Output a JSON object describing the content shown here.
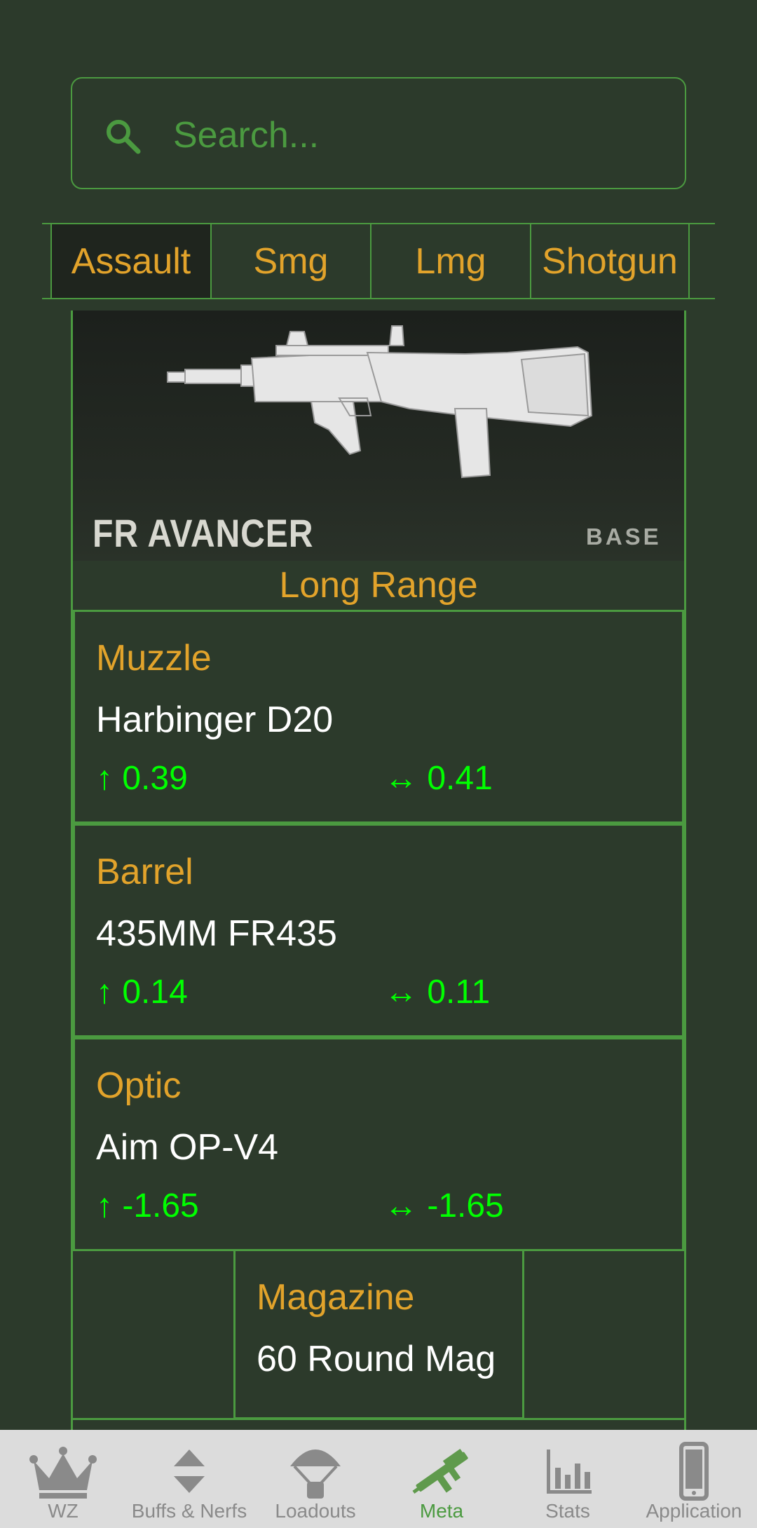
{
  "search": {
    "placeholder": "Search...",
    "value": ""
  },
  "tabs": [
    {
      "label": "Assault",
      "active": true
    },
    {
      "label": "Smg",
      "active": false
    },
    {
      "label": "Lmg",
      "active": false
    },
    {
      "label": "Shotgun",
      "active": false
    }
  ],
  "weapon": {
    "name": "FR AVANCER",
    "tag": "BASE",
    "loadout_title": "Long Range"
  },
  "attachments": [
    {
      "slot": "Muzzle",
      "name": "Harbinger D20",
      "vertical": "↑ 0.39",
      "horizontal": "↔ 0.41"
    },
    {
      "slot": "Barrel",
      "name": "435MM FR435",
      "vertical": "↑ 0.14",
      "horizontal": "↔ 0.11"
    },
    {
      "slot": "Optic",
      "name": "Aim OP-V4",
      "vertical": "↑ -1.65",
      "horizontal": "↔ -1.65"
    }
  ],
  "magazine": {
    "slot": "Magazine",
    "name": "60 Round Mag"
  },
  "bottom_nav": [
    {
      "label": "WZ",
      "icon": "crown-icon"
    },
    {
      "label": "Buffs & Nerfs",
      "icon": "up-down-arrows-icon"
    },
    {
      "label": "Loadouts",
      "icon": "parachute-icon"
    },
    {
      "label": "Meta",
      "icon": "rifle-icon",
      "active": true
    },
    {
      "label": "Stats",
      "icon": "bar-chart-icon"
    },
    {
      "label": "Application",
      "icon": "phone-icon"
    }
  ],
  "colors": {
    "background": "#2c3a2b",
    "border": "#4b9a40",
    "accent": "#e2a32b",
    "stat": "#00ff00",
    "nav_bg": "#dcdcdc"
  }
}
